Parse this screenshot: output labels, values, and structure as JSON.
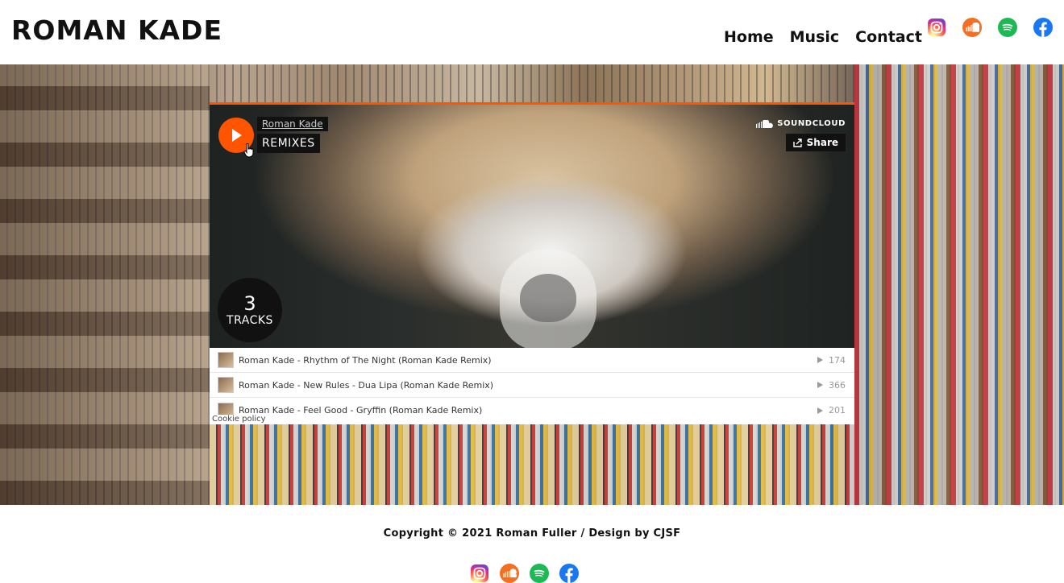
{
  "header": {
    "site_title": "ROMAN KADE",
    "nav": [
      "Home",
      "Music",
      "Contact"
    ],
    "social_icons": [
      "instagram-icon",
      "soundcloud-icon",
      "spotify-icon",
      "facebook-icon"
    ]
  },
  "player": {
    "artist": "Roman Kade",
    "playlist_title": "REMIXES",
    "brand": "SOUNDCLOUD",
    "share_label": "Share",
    "track_count": "3",
    "track_count_label": "TRACKS",
    "tracks": [
      {
        "title": "Roman Kade - Rhythm of The Night (Roman Kade Remix)",
        "plays": "174"
      },
      {
        "title": "Roman Kade - New Rules - Dua Lipa (Roman Kade Remix)",
        "plays": "366"
      },
      {
        "title": "Roman Kade - Feel Good - Gryffin (Roman Kade Remix)",
        "plays": "201"
      }
    ],
    "cookie_policy": "Cookie policy"
  },
  "footer": {
    "copyright": "Copyright © 2021 Roman Fuller / Design by CJSF"
  },
  "colors": {
    "accent": "#ff5500",
    "instagram": "#d6249f",
    "soundcloud": "#f26f23",
    "spotify": "#1db954",
    "facebook": "#1877f2"
  }
}
